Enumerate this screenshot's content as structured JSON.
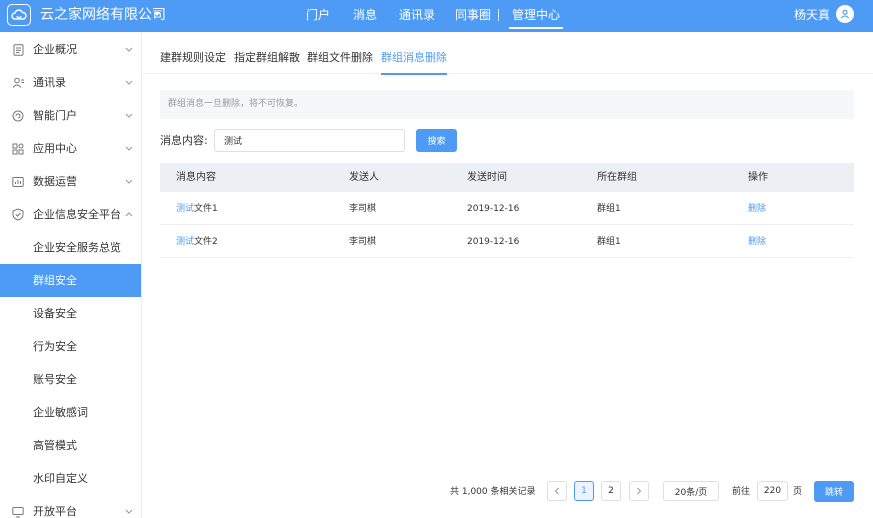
{
  "header": {
    "company": "云之家网络有限公司",
    "nav": [
      "门户",
      "消息",
      "通讯录",
      "同事圈",
      "管理中心"
    ],
    "active_nav": "管理中心",
    "user_name": "杨天真"
  },
  "sidebar": {
    "items": [
      {
        "label": "企业概况",
        "icon": "document-icon"
      },
      {
        "label": "通讯录",
        "icon": "contacts-icon"
      },
      {
        "label": "智能门户",
        "icon": "portal-icon"
      },
      {
        "label": "应用中心",
        "icon": "apps-icon"
      },
      {
        "label": "数据运营",
        "icon": "data-icon"
      },
      {
        "label": "企业信息安全平台",
        "icon": "shield-icon"
      }
    ],
    "sub_items": [
      "企业安全服务总览",
      "群组安全",
      "设备安全",
      "行为安全",
      "账号安全",
      "企业敏感词",
      "高管模式",
      "水印自定义"
    ],
    "active_sub": "群组安全",
    "last_item": {
      "label": "开放平台",
      "icon": "monitor-icon"
    }
  },
  "tabs": [
    "建群规则设定",
    "指定群组解散",
    "群组文件删除",
    "群组消息删除"
  ],
  "active_tab": "群组消息删除",
  "notice": "群组消息一旦删除，将不可恢复。",
  "search": {
    "label": "消息内容:",
    "value": "测试",
    "button": "搜索"
  },
  "table": {
    "columns": [
      "消息内容",
      "发送人",
      "发送时间",
      "所在群组",
      "操作"
    ],
    "rows": [
      {
        "keyword": "测试",
        "rest": "文件1",
        "sender": "李司棋",
        "time": "2019-12-16",
        "group": "群组1",
        "action": "删除"
      },
      {
        "keyword": "测试",
        "rest": "文件2",
        "sender": "李司棋",
        "time": "2019-12-16",
        "group": "群组1",
        "action": "删除"
      }
    ]
  },
  "pagination": {
    "total": "共 1,000 条相关记录",
    "pages": [
      "1",
      "2"
    ],
    "current": "1",
    "page_size": "20条/页",
    "goto_label": "前往",
    "goto_value": "220",
    "page_unit": "页",
    "jump": "跳转"
  },
  "colors": {
    "accent": "#4d9bf5"
  }
}
